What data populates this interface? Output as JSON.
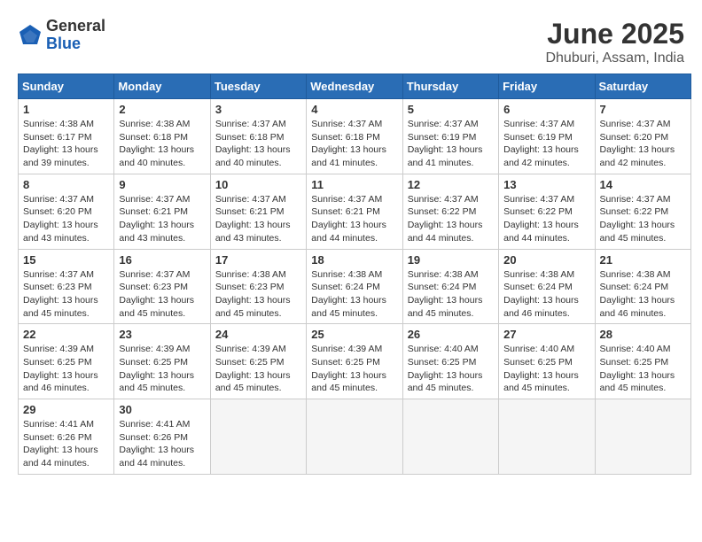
{
  "header": {
    "logo_general": "General",
    "logo_blue": "Blue",
    "month_title": "June 2025",
    "location": "Dhuburi, Assam, India"
  },
  "columns": [
    "Sunday",
    "Monday",
    "Tuesday",
    "Wednesday",
    "Thursday",
    "Friday",
    "Saturday"
  ],
  "weeks": [
    [
      {
        "day": "1",
        "sunrise": "4:38 AM",
        "sunset": "6:17 PM",
        "daylight": "13 hours and 39 minutes."
      },
      {
        "day": "2",
        "sunrise": "4:38 AM",
        "sunset": "6:18 PM",
        "daylight": "13 hours and 40 minutes."
      },
      {
        "day": "3",
        "sunrise": "4:37 AM",
        "sunset": "6:18 PM",
        "daylight": "13 hours and 40 minutes."
      },
      {
        "day": "4",
        "sunrise": "4:37 AM",
        "sunset": "6:18 PM",
        "daylight": "13 hours and 41 minutes."
      },
      {
        "day": "5",
        "sunrise": "4:37 AM",
        "sunset": "6:19 PM",
        "daylight": "13 hours and 41 minutes."
      },
      {
        "day": "6",
        "sunrise": "4:37 AM",
        "sunset": "6:19 PM",
        "daylight": "13 hours and 42 minutes."
      },
      {
        "day": "7",
        "sunrise": "4:37 AM",
        "sunset": "6:20 PM",
        "daylight": "13 hours and 42 minutes."
      }
    ],
    [
      {
        "day": "8",
        "sunrise": "4:37 AM",
        "sunset": "6:20 PM",
        "daylight": "13 hours and 43 minutes."
      },
      {
        "day": "9",
        "sunrise": "4:37 AM",
        "sunset": "6:21 PM",
        "daylight": "13 hours and 43 minutes."
      },
      {
        "day": "10",
        "sunrise": "4:37 AM",
        "sunset": "6:21 PM",
        "daylight": "13 hours and 43 minutes."
      },
      {
        "day": "11",
        "sunrise": "4:37 AM",
        "sunset": "6:21 PM",
        "daylight": "13 hours and 44 minutes."
      },
      {
        "day": "12",
        "sunrise": "4:37 AM",
        "sunset": "6:22 PM",
        "daylight": "13 hours and 44 minutes."
      },
      {
        "day": "13",
        "sunrise": "4:37 AM",
        "sunset": "6:22 PM",
        "daylight": "13 hours and 44 minutes."
      },
      {
        "day": "14",
        "sunrise": "4:37 AM",
        "sunset": "6:22 PM",
        "daylight": "13 hours and 45 minutes."
      }
    ],
    [
      {
        "day": "15",
        "sunrise": "4:37 AM",
        "sunset": "6:23 PM",
        "daylight": "13 hours and 45 minutes."
      },
      {
        "day": "16",
        "sunrise": "4:37 AM",
        "sunset": "6:23 PM",
        "daylight": "13 hours and 45 minutes."
      },
      {
        "day": "17",
        "sunrise": "4:38 AM",
        "sunset": "6:23 PM",
        "daylight": "13 hours and 45 minutes."
      },
      {
        "day": "18",
        "sunrise": "4:38 AM",
        "sunset": "6:24 PM",
        "daylight": "13 hours and 45 minutes."
      },
      {
        "day": "19",
        "sunrise": "4:38 AM",
        "sunset": "6:24 PM",
        "daylight": "13 hours and 45 minutes."
      },
      {
        "day": "20",
        "sunrise": "4:38 AM",
        "sunset": "6:24 PM",
        "daylight": "13 hours and 46 minutes."
      },
      {
        "day": "21",
        "sunrise": "4:38 AM",
        "sunset": "6:24 PM",
        "daylight": "13 hours and 46 minutes."
      }
    ],
    [
      {
        "day": "22",
        "sunrise": "4:39 AM",
        "sunset": "6:25 PM",
        "daylight": "13 hours and 46 minutes."
      },
      {
        "day": "23",
        "sunrise": "4:39 AM",
        "sunset": "6:25 PM",
        "daylight": "13 hours and 45 minutes."
      },
      {
        "day": "24",
        "sunrise": "4:39 AM",
        "sunset": "6:25 PM",
        "daylight": "13 hours and 45 minutes."
      },
      {
        "day": "25",
        "sunrise": "4:39 AM",
        "sunset": "6:25 PM",
        "daylight": "13 hours and 45 minutes."
      },
      {
        "day": "26",
        "sunrise": "4:40 AM",
        "sunset": "6:25 PM",
        "daylight": "13 hours and 45 minutes."
      },
      {
        "day": "27",
        "sunrise": "4:40 AM",
        "sunset": "6:25 PM",
        "daylight": "13 hours and 45 minutes."
      },
      {
        "day": "28",
        "sunrise": "4:40 AM",
        "sunset": "6:25 PM",
        "daylight": "13 hours and 45 minutes."
      }
    ],
    [
      {
        "day": "29",
        "sunrise": "4:41 AM",
        "sunset": "6:26 PM",
        "daylight": "13 hours and 44 minutes."
      },
      {
        "day": "30",
        "sunrise": "4:41 AM",
        "sunset": "6:26 PM",
        "daylight": "13 hours and 44 minutes."
      },
      null,
      null,
      null,
      null,
      null
    ]
  ],
  "labels": {
    "sunrise": "Sunrise:",
    "sunset": "Sunset:",
    "daylight": "Daylight:"
  }
}
